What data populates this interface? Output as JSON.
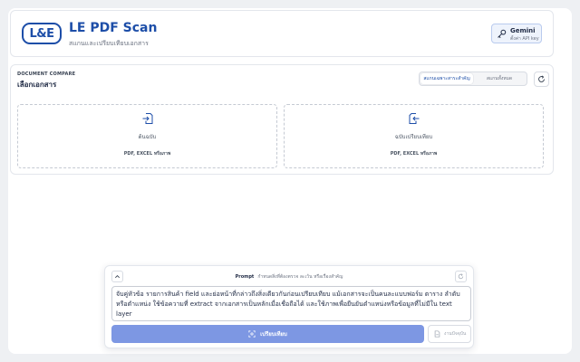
{
  "header": {
    "logo_text": "L&E",
    "title": "LE PDF Scan",
    "subtitle": "สแกนและเปรียบเทียบเอกสาร",
    "gemini_button": {
      "name": "Gemini",
      "sub": "ตั้งค่า API key",
      "icon": "key-icon"
    }
  },
  "compare": {
    "section_label": "DOCUMENT COMPARE",
    "section_title": "เลือกเอกสาร",
    "modes": [
      {
        "label": "สแกนเฉพาะสาระสำคัญ",
        "active": true
      },
      {
        "label": "สแกนทั้งหมด",
        "active": false
      }
    ],
    "reset_icon": "refresh-icon",
    "dropzones": [
      {
        "title": "ต้นฉบับ",
        "formats": "PDF, EXCEL หรือภาพ",
        "icon": "file-import-icon"
      },
      {
        "title": "ฉบับเปรียบเทียบ",
        "formats": "PDF, EXCEL หรือภาพ",
        "icon": "file-export-icon"
      }
    ]
  },
  "prompt": {
    "label": "Prompt",
    "hint": "กำหนดสิ่งที่ต้องตรวจ ละเว้น หรือเรื่องสำคัญ",
    "text": "จับคู่หัวข้อ รายการสินค้า field และย่อหน้าที่กล่าวถึงสิ่งเดียวกันก่อนเปรียบเทียบ แม้เอกสารจะเป็นคนละแบบฟอร์ม ตาราง ลำดับ หรือตำแหน่ง ใช้ข้อความที่ extract จากเอกสารเป็นหลักเมื่อเชื่อถือได้ และใช้ภาพเพื่อยืนยันตำแหน่งหรือข้อมูลที่ไม่มีใน text layer",
    "compare_button": "เปรียบเทียบ",
    "export_button": "งานปัจจุบัน"
  },
  "colors": {
    "brand": "#1d4ea8",
    "primary_button": "#7d97e3"
  }
}
